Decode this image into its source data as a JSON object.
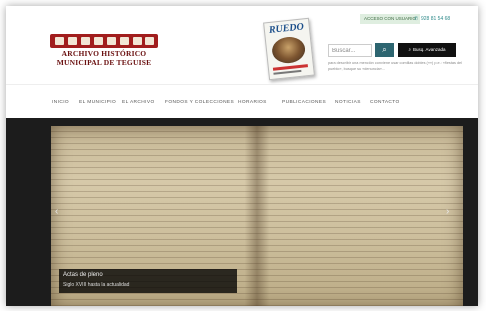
{
  "header": {
    "logo_line1": "ARCHIVO HISTÓRICO",
    "logo_line2": "MUNICIPAL DE TEGUISE",
    "magazine_title": "RUEDO",
    "badge": "ACCESO CON USUARIO",
    "phone": "928 81 54 68",
    "search_placeholder": "Buscar...",
    "search_icon": "search-icon",
    "advanced_label": "Busq. Avanzada",
    "search_help": "para describir una mención conviene usar comillas dobles («») p.e.: «fiestas del pueblo», busque su «denuncia»..."
  },
  "nav": {
    "items": [
      "INICIO",
      "EL MUNICIPIO",
      "EL ARCHIVO",
      "FONDOS Y COLECCIONES",
      "HORARIOS",
      "PUBLICACIONES",
      "NOTICIAS",
      "CONTACTO"
    ]
  },
  "slider": {
    "caption_title": "Actas de pleno",
    "caption_subtitle": "Siglo XVIII hasta la actualidad",
    "prev_icon": "chevron-left-icon",
    "next_icon": "chevron-right-icon"
  },
  "colors": {
    "logo_red": "#a11d1d",
    "search_button": "#2d6570",
    "phone_teal": "#2f8a8a"
  }
}
